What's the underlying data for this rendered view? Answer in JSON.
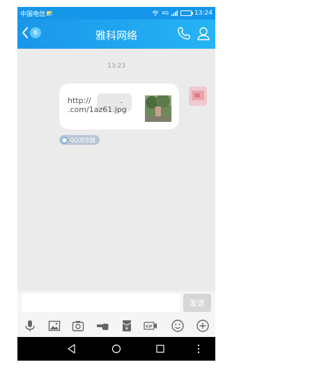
{
  "status_bar": {
    "carrier": "中国电信",
    "signal": "4G",
    "time": "13:24"
  },
  "nav": {
    "back_badge": "6",
    "title": "雅科网络",
    "icons": [
      "back-icon",
      "phone-icon",
      "profile-icon"
    ]
  },
  "chat": {
    "timestamp": "13:23",
    "message_text": "http://            .\n.com/1az61.jpg",
    "browser_tag": "QQ浏览器"
  },
  "input": {
    "value": "",
    "send_label": "发送"
  },
  "toolbar": {
    "icons": [
      "microphone-icon",
      "image-icon",
      "camera-icon",
      "poke-icon",
      "red-packet-icon",
      "gif-icon",
      "emoji-icon",
      "plus-icon"
    ]
  },
  "android_nav": {
    "icons": [
      "back-triangle-icon",
      "home-circle-icon",
      "recents-square-icon",
      "menu-dots-icon"
    ]
  },
  "colors": {
    "accent": "#1a96ea",
    "chat_bg": "#ebebeb"
  }
}
